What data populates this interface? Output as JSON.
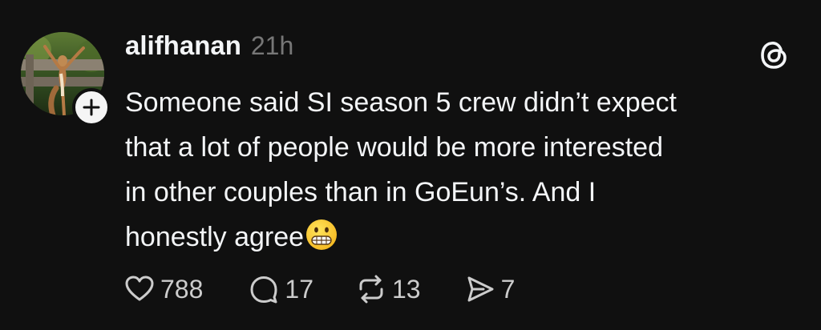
{
  "post": {
    "author": {
      "username": "alifhanan",
      "avatar_icon": "squirrel-avatar"
    },
    "timestamp": "21h",
    "body_lines": [
      "Someone said SI season 5 crew didn’t expect",
      "that a lot of people would be more interested",
      "in other couples than in GoEun’s. And I",
      "honestly agree"
    ],
    "emoji": "grimacing-face",
    "stats": {
      "likes": "788",
      "replies": "17",
      "reposts": "13",
      "shares": "7"
    }
  },
  "icons": {
    "app_logo": "threads-logo-icon",
    "follow": "plus-icon",
    "like": "heart-icon",
    "reply": "speech-bubble-icon",
    "repost": "repost-icon",
    "share": "send-icon"
  },
  "colors": {
    "background": "#101010",
    "text": "#f3f5f7",
    "muted": "#777777"
  }
}
